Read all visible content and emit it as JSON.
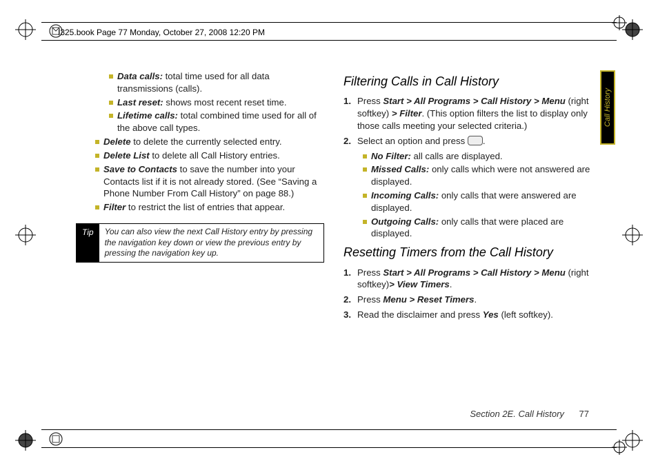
{
  "header": {
    "stamp": "I325.book  Page 77  Monday, October 27, 2008  12:20 PM"
  },
  "sidetab": {
    "label": "Call History"
  },
  "left": {
    "bullets_inner": [
      {
        "term": "Data calls:",
        "rest": " total time used for all data transmissions (calls)."
      },
      {
        "term": "Last reset:",
        "rest": " shows most recent reset time."
      },
      {
        "term": "Lifetime calls:",
        "rest": " total combined time used for all of the above call types."
      }
    ],
    "bullets_outer": [
      {
        "term": "Delete",
        "rest": " to delete the currently selected entry."
      },
      {
        "term": "Delete List",
        "rest": " to delete all Call History entries."
      },
      {
        "term": "Save to Contacts",
        "rest": " to save the number into your Contacts list if it is not already stored. (See “Saving a Phone Number From Call History” on page 88.)"
      },
      {
        "term": "Filter",
        "rest": " to restrict the list of entries that appear."
      }
    ],
    "tip_label": "Tip",
    "tip_body": "You can also view the next Call History entry by pressing the navigation key down or view the previous entry by pressing the navigation key up."
  },
  "right": {
    "h_filter": "Filtering Calls in Call History",
    "step1_pre": "Press ",
    "step1_path": "Start > All Programs > Call History > Menu",
    "step1_mid": " (right softkey) ",
    "step1_path2": "> Filter",
    "step1_post": ". (This option filters the list to display only those calls meeting your selected criteria.)",
    "step2_pre": "Select an option and press ",
    "step2_post": ".",
    "filter_opts": [
      {
        "term": "No Filter:",
        "rest": " all calls are displayed."
      },
      {
        "term": "Missed Calls:",
        "rest": " only calls which were not answered are displayed."
      },
      {
        "term": "Incoming Calls:",
        "rest": " only calls that were answered are displayed."
      },
      {
        "term": "Outgoing Calls:",
        "rest": " only calls that were placed are displayed."
      }
    ],
    "h_reset": "Resetting Timers from the Call History",
    "r_step1_pre": "Press ",
    "r_step1_path": "Start > All Programs > Call History > Menu",
    "r_step1_mid": " (right softkey)",
    "r_step1_path2": "> View Timers",
    "r_step1_post": ".",
    "r_step2_pre": "Press ",
    "r_step2_path": "Menu > Reset Timers",
    "r_step2_post": ".",
    "r_step3_pre": "Read the disclaimer and press ",
    "r_step3_term": "Yes",
    "r_step3_post": " (left softkey)."
  },
  "footer": {
    "section": "Section 2E. Call History",
    "page": "77"
  }
}
